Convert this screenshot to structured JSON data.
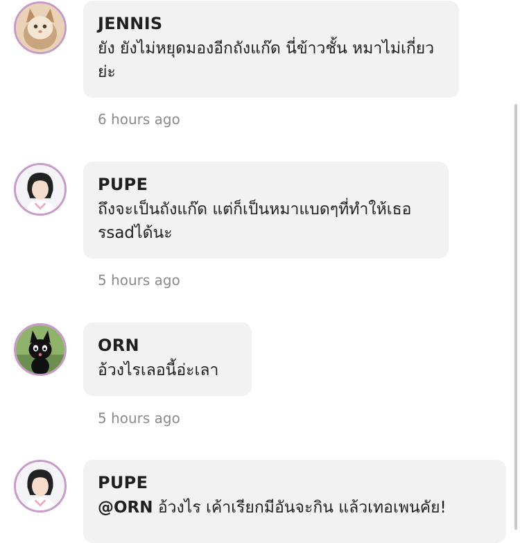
{
  "comments": [
    {
      "author": "JENNIS",
      "text": "ยัง ยังไม่หยุดมองอีกถังแก๊ด นี่ข้าวชั้น หมาไม่เกี่ยวย่ะ",
      "time": "6 hours ago",
      "avatar": "cat-avatar"
    },
    {
      "author": "PUPE",
      "text": "ถึงจะเป็นถังแก๊ด แต่ก็เป็นหมาแบดๆที่ทำให้เธอรsadได้นะ",
      "time": "5 hours ago",
      "avatar": "girl-avatar"
    },
    {
      "author": "ORN",
      "text": "อ้วงไรเลอนี้อ่ะเลา",
      "time": "5 hours ago",
      "avatar": "black-cat-avatar"
    },
    {
      "author": "PUPE",
      "mention": "@ORN",
      "text": "อ้วงไร เค้าเรียกมีอันจะกิน แล้วเทอเพนคัย!",
      "avatar": "girl-avatar"
    }
  ],
  "colors": {
    "bubble": "#f2f2f2",
    "avatar_ring": "#c79ac9",
    "timestamp": "#8a8a8a"
  }
}
